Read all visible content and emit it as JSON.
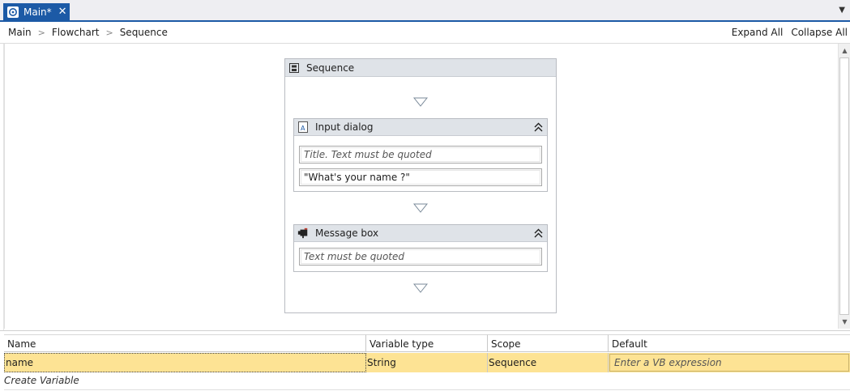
{
  "tab": {
    "label": "Main*",
    "close_glyph": "✕",
    "icon": "workflow-icon",
    "accent_color": "#1c5aa6"
  },
  "breadcrumb": {
    "items": [
      "Main",
      "Flowchart",
      "Sequence"
    ],
    "separator": ">"
  },
  "actions": {
    "expand_all": "Expand All",
    "collapse_all": "Collapse All"
  },
  "designer": {
    "sequence": {
      "title": "Sequence",
      "icon": "sequence-icon",
      "activities": [
        {
          "title": "Input dialog",
          "icon": "input-dialog-icon",
          "fields": [
            {
              "value": "",
              "placeholder": "Title. Text must be quoted"
            },
            {
              "value": "\"What's your name ?\"",
              "placeholder": ""
            }
          ]
        },
        {
          "title": "Message box",
          "icon": "message-box-icon",
          "fields": [
            {
              "value": "",
              "placeholder": "Text must be quoted"
            }
          ]
        }
      ]
    }
  },
  "variables": {
    "columns": [
      "Name",
      "Variable type",
      "Scope",
      "Default"
    ],
    "rows": [
      {
        "name": "name",
        "type": "String",
        "scope": "Sequence",
        "default_placeholder": "Enter a VB expression"
      }
    ],
    "create_label": "Create Variable",
    "highlight_color": "#fde394"
  }
}
